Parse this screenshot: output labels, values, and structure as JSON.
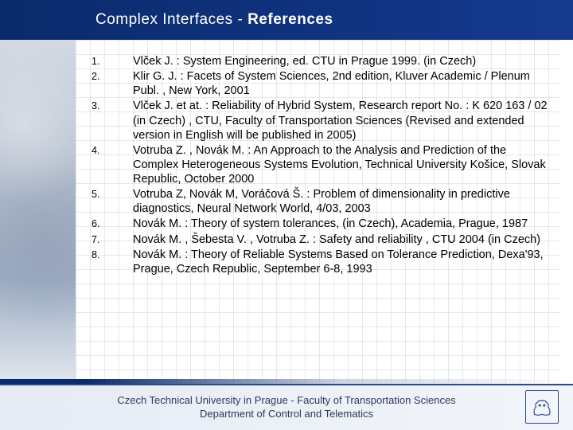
{
  "title": {
    "main": "Complex Interfaces - ",
    "sub": "References"
  },
  "references": [
    {
      "num": "1.",
      "text": "Vlček J. : System Engineering, ed. CTU in Prague 1999.  (in Czech)"
    },
    {
      "num": "2.",
      "text": "Klir G. J. : Facets of System Sciences, 2nd edition,  Kluver Academic / Plenum Publ. , New York, 2001"
    },
    {
      "num": "3.",
      "text": "Vlček J. et at. : Reliability of Hybrid System, Research report No. : K 620 163 / 02 (in Czech)  , CTU, Faculty of Transportation Sciences (Revised and extended version    in English will be published in 2005)"
    },
    {
      "num": "4.",
      "text": "Votruba Z. , Novák M. : An Approach to the Analysis and Prediction of the Complex Heterogeneous Systems Evolution, Technical University Košice, Slovak Republic, October 2000"
    },
    {
      "num": "5.",
      "text": "Votruba Z, Novák M, Voráčová Š. : Problem of dimensionality in predictive diagnostics, Neural Network World, 4/03, 2003"
    },
    {
      "num": "6.",
      "text": "Novák M. : Theory of system tolerances, (in Czech), Academia, Prague, 1987"
    },
    {
      "num": "7.",
      "text": "Novák M. , Šebesta V. , Votruba Z. : Safety and reliability , CTU 2004 (in Czech)"
    },
    {
      "num": "8.",
      "text": "Novák M. : Theory of Reliable Systems Based on Tolerance Prediction, Dexa'93, Prague, Czech Republic, September 6-8, 1993"
    }
  ],
  "footer": {
    "line1": "Czech Technical University in Prague - Faculty of Transportation Sciences",
    "line2": "Department of Control and Telematics"
  }
}
